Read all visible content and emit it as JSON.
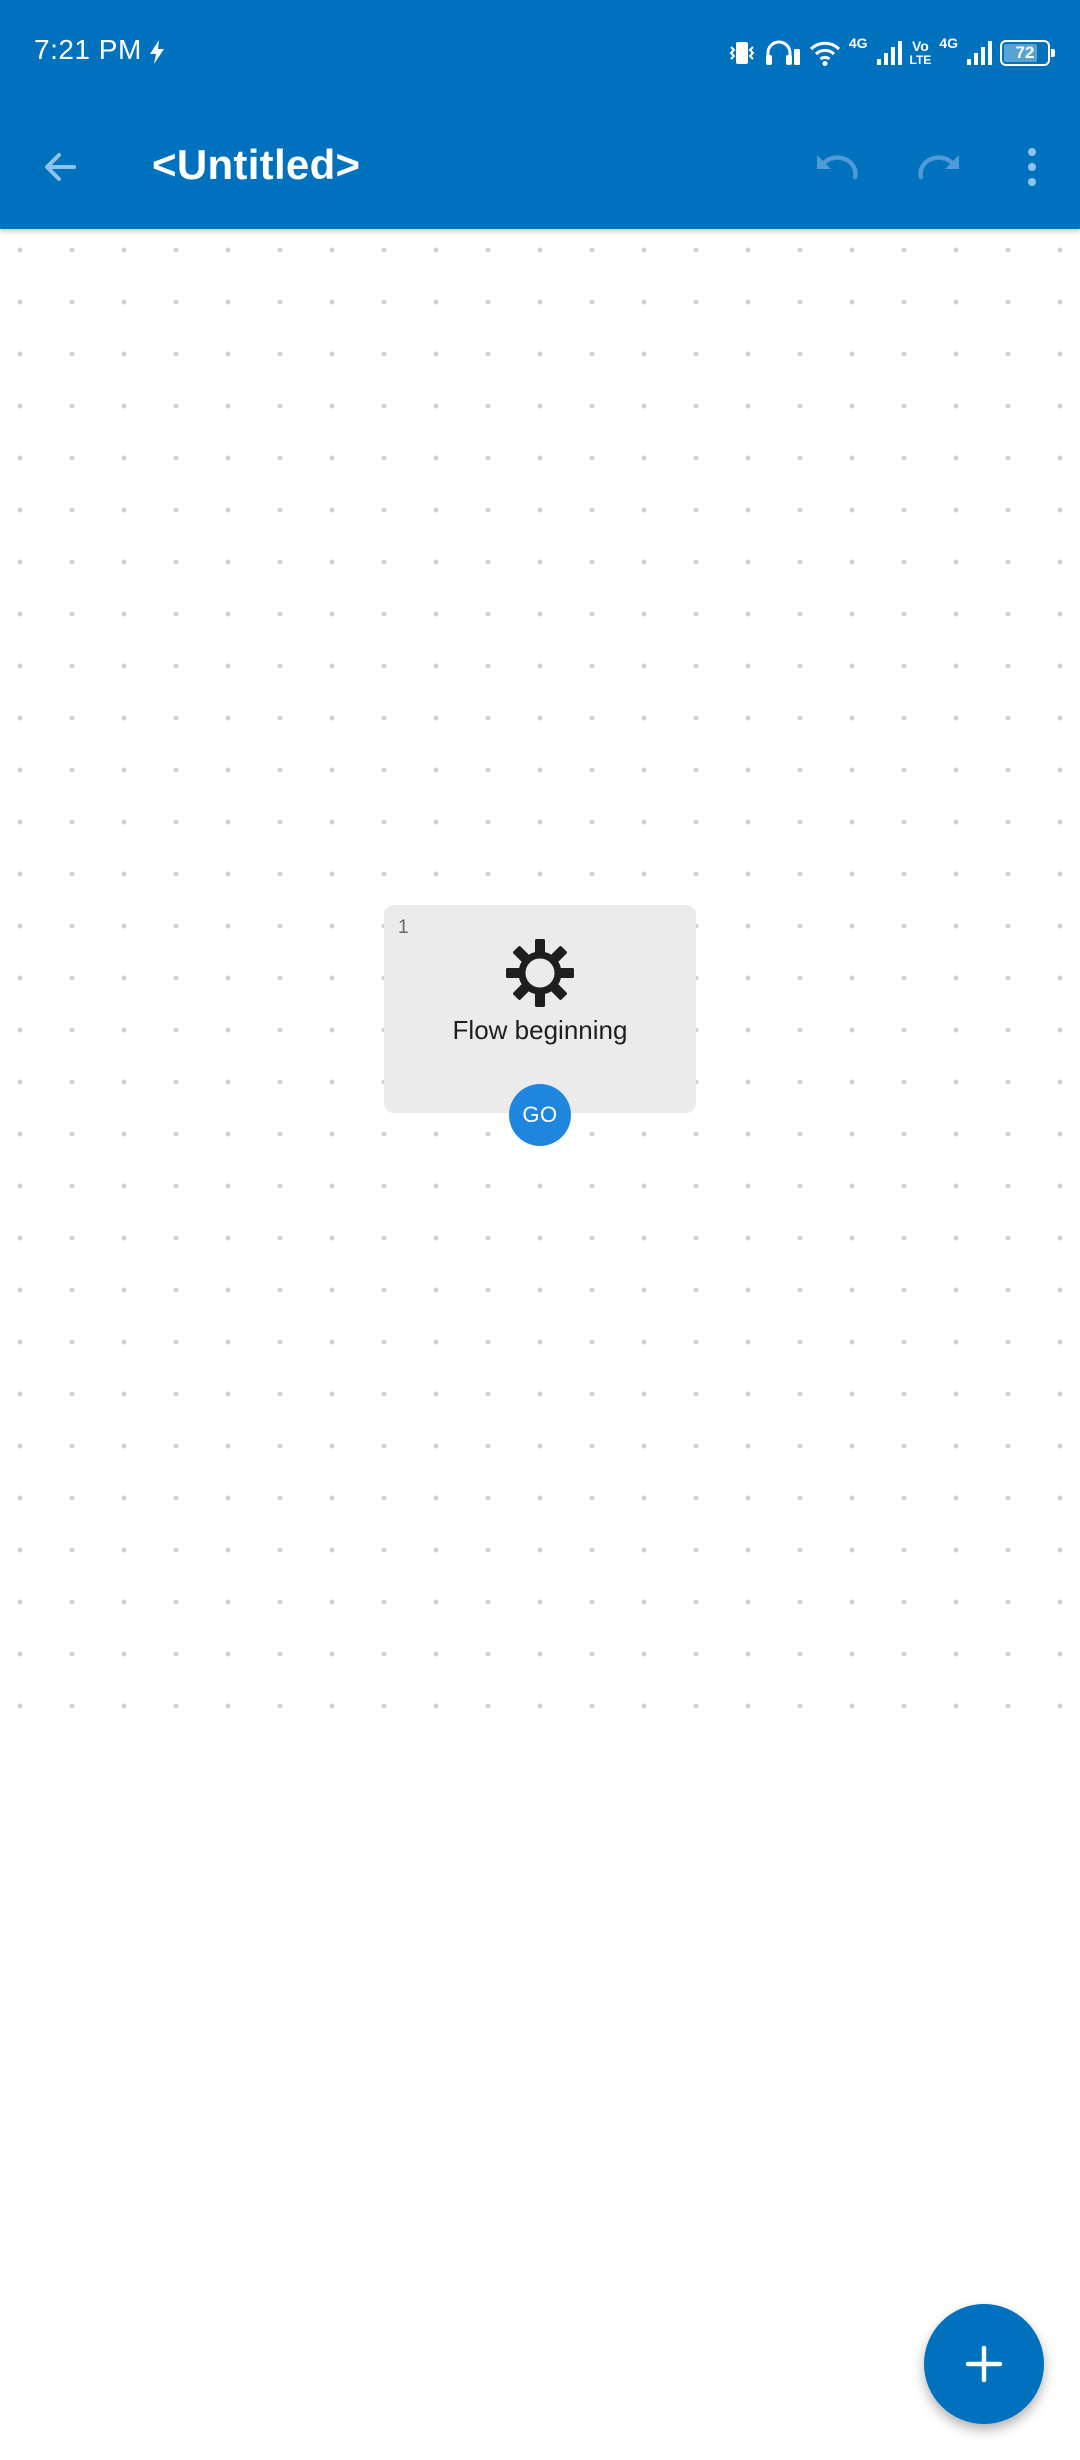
{
  "status_bar": {
    "time": "7:21 PM",
    "network_4g_1": "4G",
    "volte_top": "Vo",
    "volte_bottom": "LTE",
    "network_4g_2": "4G",
    "battery_level": "72"
  },
  "app_bar": {
    "title": "<Untitled>",
    "icons": {
      "back": "arrow-back-icon",
      "undo": "undo-icon",
      "redo": "redo-icon",
      "more": "more-vert-icon"
    }
  },
  "flow_node": {
    "number": "1",
    "label": "Flow beginning",
    "icon": "gear-icon",
    "go_label": "GO"
  },
  "fab": {
    "icon": "plus-icon"
  },
  "colors": {
    "primary": "#0071bd",
    "go_button": "#1f86e0",
    "node_background": "#ebebeb",
    "grid_dot": "#d0d0d0"
  }
}
